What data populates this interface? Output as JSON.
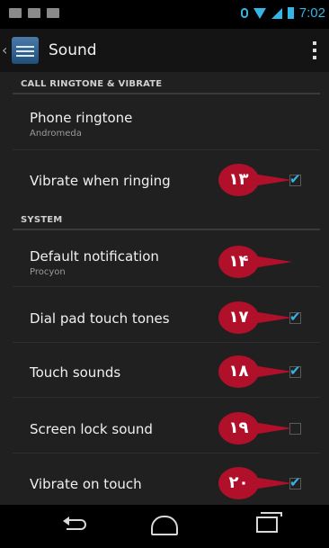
{
  "status_bar": {
    "time": "7:02",
    "icons": [
      "mail-icon",
      "message-icon",
      "image-icon",
      "alarm-icon",
      "wifi-icon",
      "signal-icon",
      "battery-icon"
    ]
  },
  "action_bar": {
    "title": "Sound",
    "up_glyph": "‹",
    "overflow_icon": "overflow-menu-icon"
  },
  "sections": {
    "call": "CALL RINGTONE & VIBRATE",
    "system": "SYSTEM"
  },
  "settings": {
    "phone_ringtone": {
      "title": "Phone ringtone",
      "summary": "Andromeda"
    },
    "vibrate_when_ringing": {
      "title": "Vibrate when ringing",
      "checked": true
    },
    "default_notification": {
      "title": "Default notification",
      "summary": "Procyon"
    },
    "dial_pad_touch_tones": {
      "title": "Dial pad touch tones",
      "checked": true
    },
    "touch_sounds": {
      "title": "Touch sounds",
      "checked": true
    },
    "screen_lock_sound": {
      "title": "Screen lock sound",
      "checked": false
    },
    "vibrate_on_touch": {
      "title": "Vibrate on touch",
      "checked": true
    }
  },
  "markers": {
    "vibrate_when_ringing": "۱۳",
    "default_notification": "۱۴",
    "dial_pad_touch_tones": "۱۷",
    "touch_sounds": "۱۸",
    "screen_lock_sound": "۱۹",
    "vibrate_on_touch": "۲۰"
  },
  "colors": {
    "accent": "#33b5e5",
    "marker": "#b0102a",
    "background": "#202020"
  },
  "nav_bar": {
    "icons": [
      "back-icon",
      "home-icon",
      "recent-apps-icon"
    ]
  }
}
